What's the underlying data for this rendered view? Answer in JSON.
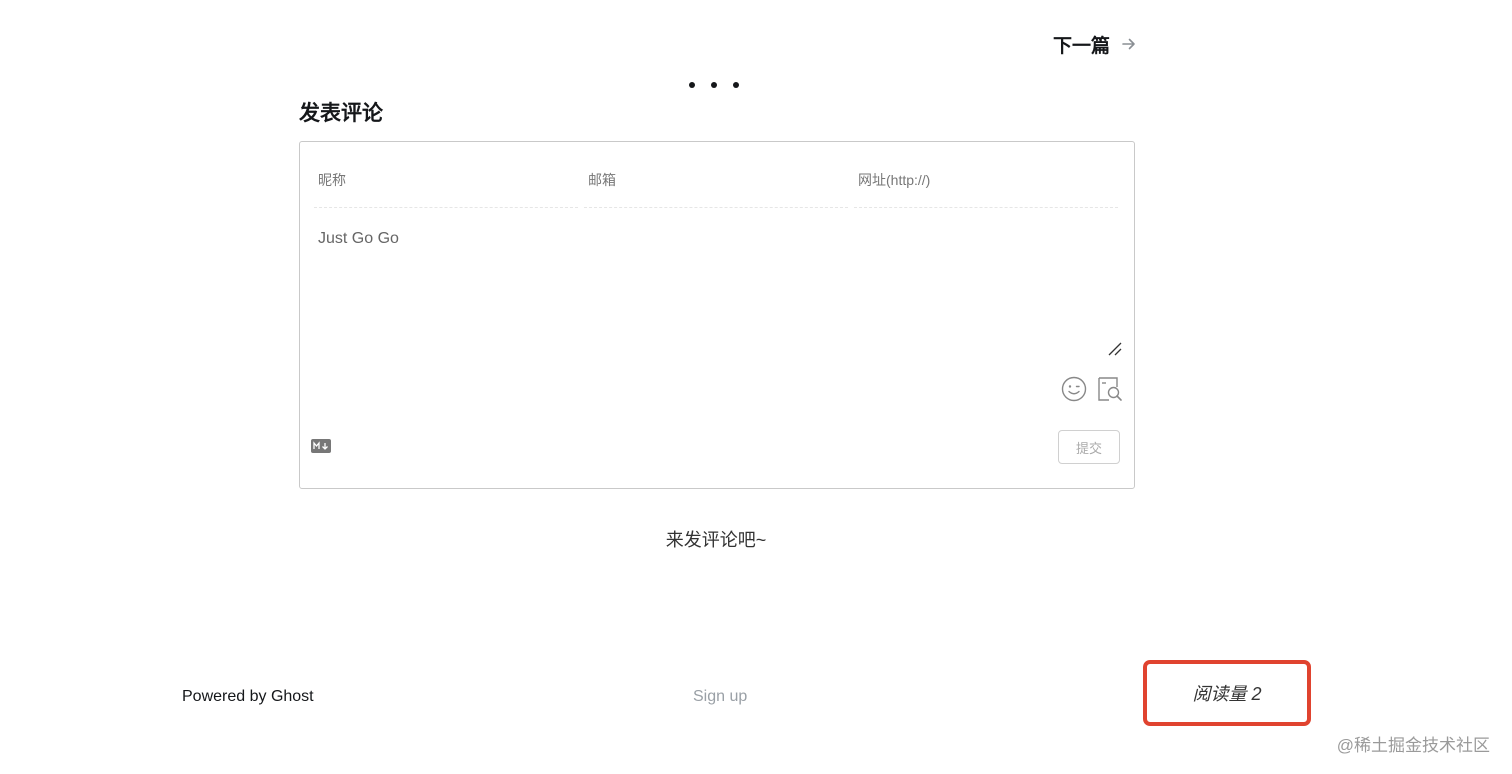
{
  "nav": {
    "next_label": "下一篇"
  },
  "comments": {
    "title": "发表评论",
    "form": {
      "nickname_placeholder": "昵称",
      "email_placeholder": "邮箱",
      "website_placeholder": "网址(http://)",
      "textarea_placeholder": "Just Go Go",
      "submit_label": "提交"
    },
    "empty_hint": "来发评论吧~"
  },
  "footer": {
    "powered_by": "Powered by Ghost",
    "signup_label": "Sign up",
    "views_label": "阅读量 2"
  },
  "watermark": "@稀土掘金技术社区",
  "colors": {
    "highlight_border": "#e0432f",
    "text": "#15171a",
    "muted": "#9aa0a6"
  }
}
